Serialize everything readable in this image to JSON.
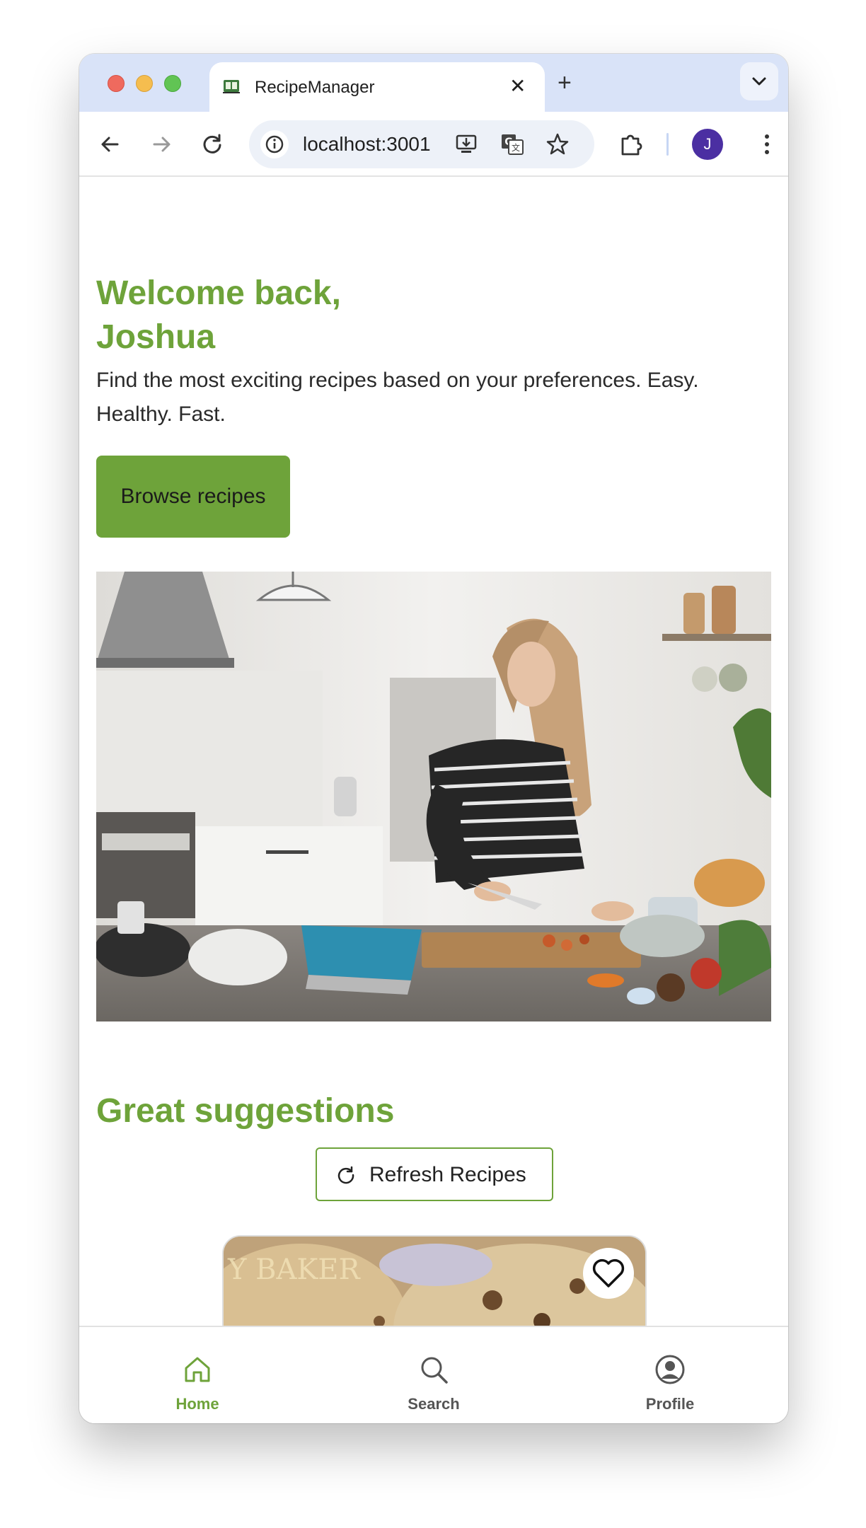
{
  "browser": {
    "tab_title": "RecipeManager",
    "tab_close": "✕",
    "new_tab": "+",
    "url": "localhost:3001",
    "avatar_initial": "J"
  },
  "hero": {
    "title": "Welcome back, Joshua",
    "subtitle": "Find the most exciting recipes based on your preferences. Easy. Healthy. Fast.",
    "cta_label": "Browse recipes"
  },
  "suggestions": {
    "heading": "Great suggestions",
    "refresh_label": "Refresh Recipes",
    "card_watermark": "Y BAKER"
  },
  "bottom_nav": {
    "items": [
      {
        "label": "Home",
        "icon": "home-icon",
        "active": true
      },
      {
        "label": "Search",
        "icon": "search-icon",
        "active": false
      },
      {
        "label": "Profile",
        "icon": "profile-icon",
        "active": false
      }
    ]
  },
  "colors": {
    "accent": "#6ea33a",
    "tab_strip": "#d9e3f8",
    "avatar": "#4b2fa2",
    "inactive_nav": "#555555"
  }
}
